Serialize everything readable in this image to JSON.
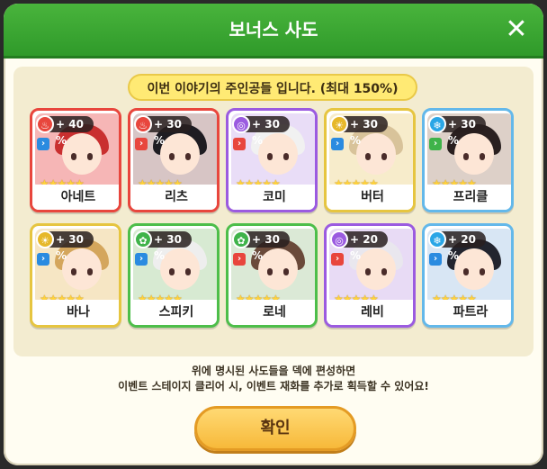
{
  "dialog": {
    "title": "보너스 사도",
    "close_icon": "close-icon",
    "banner": "이번 이야기의 주인공들 입니다. (최대 150%)",
    "description_line1": "위에 명시된 사도들을 덱에 편성하면",
    "description_line2": "이벤트 스테이지 클리어 시, 이벤트 재화를 추가로 획득할 수 있어요!",
    "confirm_label": "확인"
  },
  "colors": {
    "header_green": "#3aa833",
    "banner_yellow": "#ffea74",
    "button_orange": "#f7b93a"
  },
  "characters": [
    {
      "name": "아네트",
      "bonus": "+ 40 %",
      "element": "fire",
      "element_glyph": "♨",
      "element_color": "#e8463d",
      "border": "#e8463d",
      "bg": "#f6b6b6",
      "hair": "#c92f2f",
      "type_color": "#2a8be0",
      "type_glyph": "›",
      "stars": "★★★★★"
    },
    {
      "name": "리츠",
      "bonus": "+ 30 %",
      "element": "fire",
      "element_glyph": "♨",
      "element_color": "#e8463d",
      "border": "#e8463d",
      "bg": "#d7c5c5",
      "hair": "#1e1c22",
      "type_color": "#e8463d",
      "type_glyph": "›",
      "stars": "★★★★★"
    },
    {
      "name": "코미",
      "bonus": "+ 30 %",
      "element": "dark",
      "element_glyph": "◎",
      "element_color": "#9b5be0",
      "border": "#9b5be0",
      "bg": "#e9ddf7",
      "hair": "#f1f1f1",
      "type_color": "#e8463d",
      "type_glyph": "›",
      "stars": "★★★★★"
    },
    {
      "name": "버터",
      "bonus": "+ 30 %",
      "element": "light",
      "element_glyph": "☀",
      "element_color": "#e6b82a",
      "border": "#e6c540",
      "bg": "#f7eccb",
      "hair": "#d8c39a",
      "type_color": "#2a8be0",
      "type_glyph": "›",
      "stars": "★★★★★"
    },
    {
      "name": "프리클",
      "bonus": "+ 30 %",
      "element": "water",
      "element_glyph": "❄",
      "element_color": "#2aa6e6",
      "border": "#63b8ea",
      "bg": "#ddd0c8",
      "hair": "#2a2020",
      "type_color": "#3fb34a",
      "type_glyph": "›",
      "stars": "★★★★★"
    },
    {
      "name": "바나",
      "bonus": "+ 30 %",
      "element": "light",
      "element_glyph": "☀",
      "element_color": "#e6b82a",
      "border": "#e6c540",
      "bg": "#f6e6c4",
      "hair": "#d4a65c",
      "type_color": "#2a8be0",
      "type_glyph": "›",
      "stars": "★★★★★"
    },
    {
      "name": "스피키",
      "bonus": "+ 30 %",
      "element": "nature",
      "element_glyph": "✿",
      "element_color": "#3fb34a",
      "border": "#4dbe4a",
      "bg": "#d7ead2",
      "hair": "#eeeeee",
      "type_color": "#2a8be0",
      "type_glyph": "›",
      "stars": "★★★★★"
    },
    {
      "name": "로네",
      "bonus": "+ 30 %",
      "element": "nature",
      "element_glyph": "✿",
      "element_color": "#3fb34a",
      "border": "#4dbe4a",
      "bg": "#dbe9d6",
      "hair": "#6a4a3a",
      "type_color": "#e8463d",
      "type_glyph": "›",
      "stars": "★★★★★"
    },
    {
      "name": "레비",
      "bonus": "+ 20 %",
      "element": "dark",
      "element_glyph": "◎",
      "element_color": "#9b5be0",
      "border": "#9b5be0",
      "bg": "#e8dbf5",
      "hair": "#e9e7ee",
      "type_color": "#e8463d",
      "type_glyph": "›",
      "stars": "★★★★★"
    },
    {
      "name": "파트라",
      "bonus": "+ 20 %",
      "element": "water",
      "element_glyph": "❄",
      "element_color": "#2aa6e6",
      "border": "#63b8ea",
      "bg": "#d8e6f4",
      "hair": "#22242e",
      "type_color": "#2a8be0",
      "type_glyph": "›",
      "stars": "★★★★★"
    }
  ]
}
